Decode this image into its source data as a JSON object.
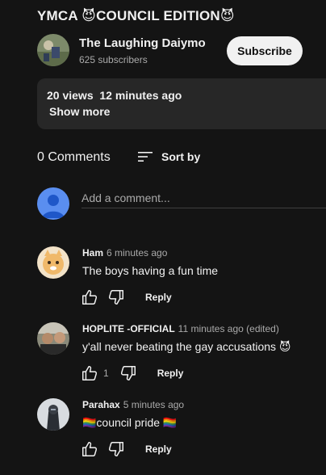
{
  "video": {
    "title": "YMCA 😈COUNCIL EDITION😈"
  },
  "channel": {
    "name": "The Laughing Daiymo",
    "subscribers": "625 subscribers",
    "subscribe_label": "Subscribe"
  },
  "description": {
    "stats": "20 views  12 minutes ago",
    "show_more": "Show more"
  },
  "comments": {
    "count_label": "0 Comments",
    "sort_label": "Sort by",
    "add_placeholder": "Add a comment...",
    "items": [
      {
        "author": "Ham",
        "time": "6 minutes ago",
        "text": "The boys having a fun time",
        "likes": "",
        "reply_label": "Reply"
      },
      {
        "author": "HOPLITE -OFFICIAL",
        "time": "11 minutes ago (edited)",
        "text": "y'all never beating the gay accusations 😈",
        "likes": "1",
        "reply_label": "Reply"
      },
      {
        "author": "Parahax",
        "time": "5 minutes ago",
        "text": "🏳️‍🌈council pride 🏳️‍🌈",
        "likes": "",
        "reply_label": "Reply"
      }
    ]
  },
  "colors": {
    "background": "#141414",
    "surface": "#272727",
    "text": "#f1f1f1",
    "secondary_text": "#aaaaaa",
    "my_avatar": "#5a8ef0"
  }
}
